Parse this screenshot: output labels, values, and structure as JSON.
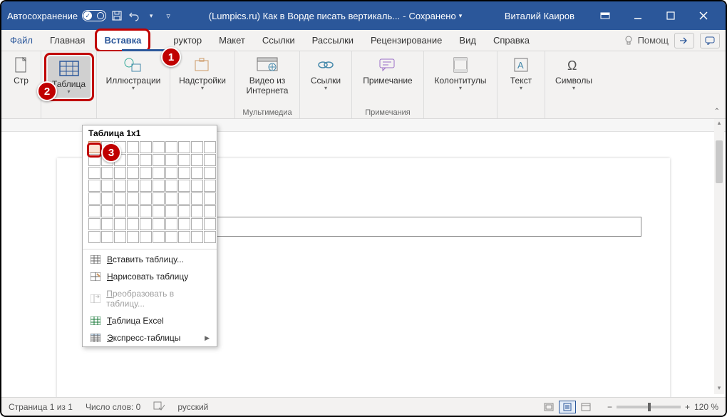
{
  "titlebar": {
    "autosave": "Автосохранение",
    "doc_title": "(Lumpics.ru) Как в Ворде писать вертикаль...",
    "saved": "Сохранено",
    "user": "Виталий Каиров"
  },
  "tabs": {
    "file": "Файл",
    "home": "Главная",
    "insert": "Вставка",
    "constructor_hidden": "руктор",
    "layout": "Макет",
    "references": "Ссылки",
    "mailings": "Рассылки",
    "review": "Рецензирование",
    "view": "Вид",
    "help_tab": "Справка",
    "help_search": "Помощ"
  },
  "ribbon": {
    "pages": {
      "label": "Стр"
    },
    "table": {
      "label": "Таблица"
    },
    "illustrations": {
      "label": "Иллюстрации"
    },
    "addins": {
      "label": "Надстройки"
    },
    "video": {
      "line1": "Видео из",
      "line2": "Интернета",
      "group": "Мультимедиа"
    },
    "links": {
      "label": "Ссылки"
    },
    "comment": {
      "label": "Примечание",
      "group": "Примечания"
    },
    "headers": {
      "label": "Колонтитулы"
    },
    "text": {
      "label": "Текст"
    },
    "symbols": {
      "label": "Символы"
    }
  },
  "dropdown": {
    "header": "Таблица 1x1",
    "insert": "Вставить таблицу...",
    "draw": "Нарисовать таблицу",
    "convert": "Преобразовать в таблицу...",
    "excel": "Таблица Excel",
    "express": "Экспресс-таблицы"
  },
  "status": {
    "page": "Страница 1 из 1",
    "words": "Число слов: 0",
    "lang": "русский",
    "zoom": "120 %"
  },
  "steps": {
    "s1": "1",
    "s2": "2",
    "s3": "3"
  }
}
